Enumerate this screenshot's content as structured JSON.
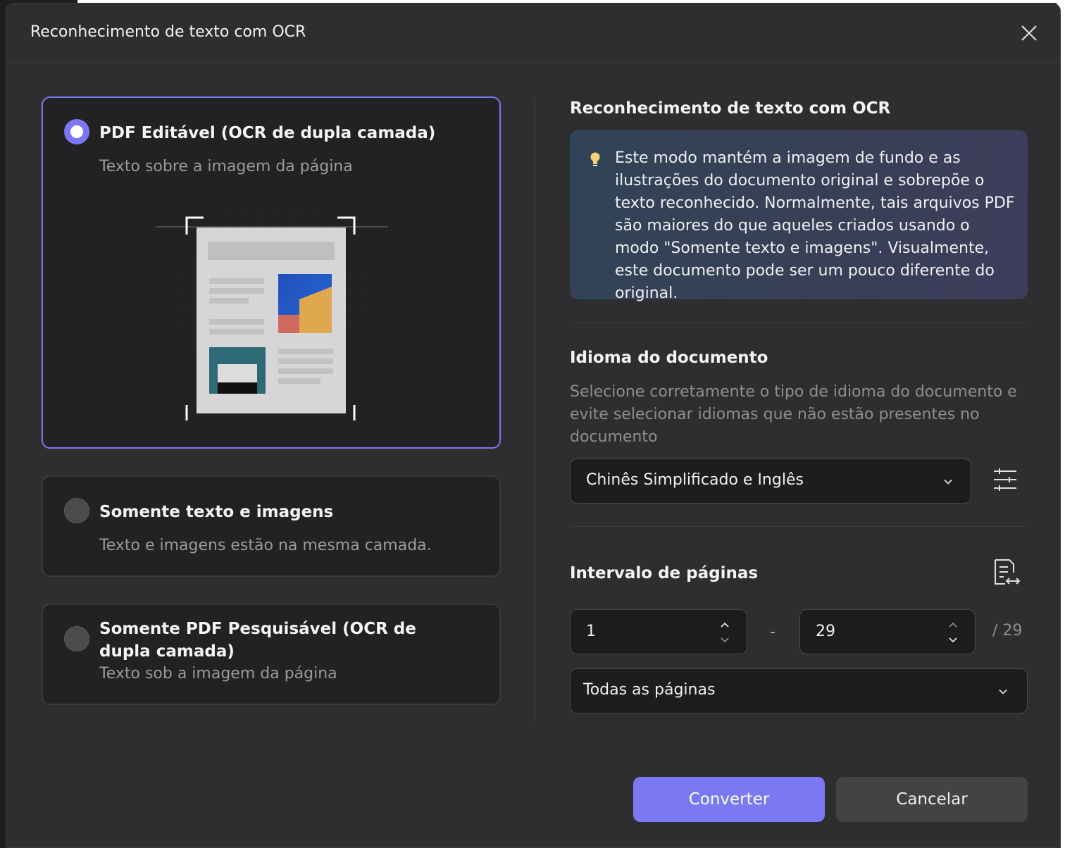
{
  "dialog": {
    "title": "Reconhecimento de texto com OCR"
  },
  "options": [
    {
      "title": "PDF Editável (OCR de dupla camada)",
      "subtitle": "Texto sobre a imagem da página",
      "selected": true
    },
    {
      "title": "Somente texto e imagens",
      "subtitle": "Texto e imagens estão na mesma camada.",
      "selected": false
    },
    {
      "title": "Somente PDF Pesquisável (OCR de dupla camada)",
      "subtitle": "Texto sob a imagem da página",
      "selected": false
    }
  ],
  "ocr_section": {
    "title": "Reconhecimento de texto com OCR",
    "info": "Este modo mantém a imagem de fundo e as ilustrações do documento original e sobrepõe o texto reconhecido. Normalmente, tais arquivos PDF são maiores do que aqueles criados usando o modo \"Somente texto e imagens\". Visualmente, este documento pode ser um pouco diferente do original."
  },
  "language": {
    "title": "Idioma do documento",
    "description": "Selecione corretamente o tipo de idioma do documento e evite selecionar idiomas que não estão presentes no documento",
    "selected": "Chinês Simplificado e Inglês"
  },
  "page_range": {
    "title": "Intervalo de páginas",
    "from": "1",
    "separator": "-",
    "to": "29",
    "total": "/ 29",
    "mode": "Todas as páginas"
  },
  "buttons": {
    "convert": "Converter",
    "cancel": "Cancelar"
  },
  "colors": {
    "accent": "#7b78f4",
    "dialog_bg": "#2e2e30",
    "card_bg": "#222224"
  }
}
